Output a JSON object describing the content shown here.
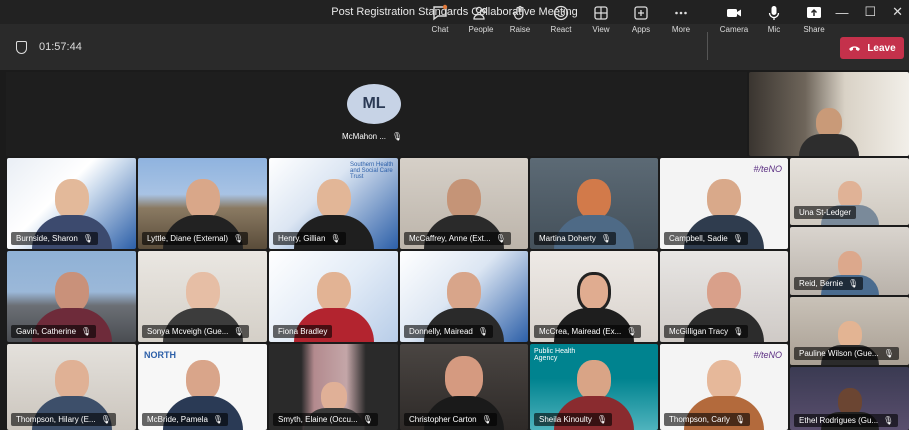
{
  "window": {
    "title": "Post Registration Standards Collaborative Meeting",
    "controls": [
      "—",
      "☐",
      "✕"
    ]
  },
  "toolbar": {
    "timer": "01:57:44",
    "buttons": [
      {
        "label": "Chat",
        "icon": "chat-icon"
      },
      {
        "label": "People",
        "icon": "people-icon"
      },
      {
        "label": "Raise",
        "icon": "hand-icon"
      },
      {
        "label": "React",
        "icon": "smile-icon"
      },
      {
        "label": "View",
        "icon": "grid-icon"
      },
      {
        "label": "Apps",
        "icon": "plus-icon"
      },
      {
        "label": "More",
        "icon": "ellipsis-icon"
      },
      {
        "label": "Camera",
        "icon": "camera-icon"
      },
      {
        "label": "Mic",
        "icon": "mic-icon"
      },
      {
        "label": "Share",
        "icon": "share-icon"
      }
    ],
    "leave_label": "Leave"
  },
  "stage": {
    "avatar_initials": "ML",
    "avatar_name": "McMahon ..."
  },
  "participants": [
    {
      "name": "Burnside, Sharon"
    },
    {
      "name": "Lyttle, Diane (External)"
    },
    {
      "name": "Henry, Gillian"
    },
    {
      "name": "McCaffrey, Anne (Ext..."
    },
    {
      "name": "Martina Doherty"
    },
    {
      "name": "Campbell, Sadie"
    },
    {
      "name": "Una St-Ledger"
    },
    {
      "name": "Gavin, Catherine"
    },
    {
      "name": "Sonya Mcveigh (Gue..."
    },
    {
      "name": "Fiona Bradley"
    },
    {
      "name": "Donnelly, Mairead"
    },
    {
      "name": "McCrea, Mairead (Ex..."
    },
    {
      "name": "McGilligan Tracy"
    },
    {
      "name": "Reid, Bernie"
    },
    {
      "name": "Pauline Wilson (Gue..."
    },
    {
      "name": "Thompson, Hilary (E..."
    },
    {
      "name": "McBride, Pamela"
    },
    {
      "name": "Smyth, Elaine (Occu..."
    },
    {
      "name": "Christopher Carton"
    },
    {
      "name": "Sheila Kinoulty"
    },
    {
      "name": "Thompson, Carly"
    },
    {
      "name": "Ethel Rodrigues (Gu..."
    }
  ],
  "banners": {
    "trust_name": "Southern Health and Social Care Trust",
    "public_health": "Public Health Agency",
    "north": "NORTH",
    "hashtag": "#/teNO"
  }
}
